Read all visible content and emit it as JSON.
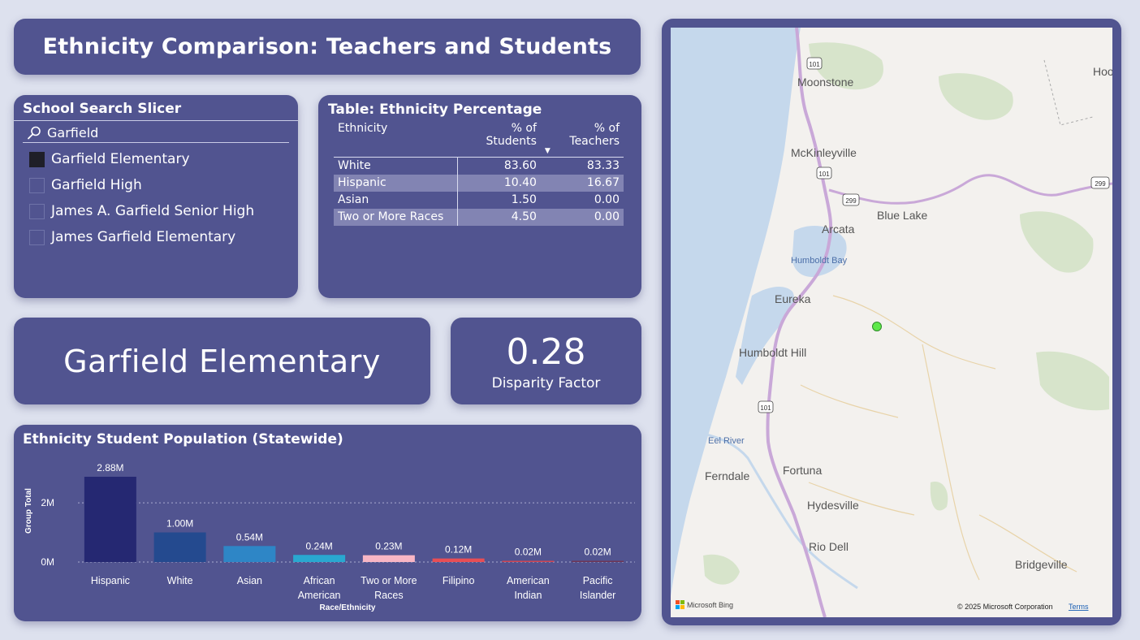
{
  "title": "Ethnicity Comparison: Teachers and Students",
  "slicer": {
    "title": "School Search Slicer",
    "search_value": "Garfield",
    "items": [
      {
        "label": "Garfield Elementary",
        "checked": true
      },
      {
        "label": "Garfield High",
        "checked": false
      },
      {
        "label": "James A. Garfield Senior High",
        "checked": false
      },
      {
        "label": "James Garfield Elementary",
        "checked": false
      }
    ]
  },
  "table": {
    "title": "Table: Ethnicity Percentage",
    "columns": [
      "Ethnicity",
      "% of Students",
      "% of Teachers"
    ],
    "rows": [
      [
        "White",
        "83.60",
        "83.33"
      ],
      [
        "Hispanic",
        "10.40",
        "16.67"
      ],
      [
        "Asian",
        "1.50",
        "0.00"
      ],
      [
        "Two or More Races",
        "4.50",
        "0.00"
      ]
    ]
  },
  "school_card": {
    "name": "Garfield Elementary"
  },
  "kpi": {
    "value": "0.28",
    "label": "Disparity Factor"
  },
  "chart_data": {
    "type": "bar",
    "title": "Ethnicity Student Population (Statewide)",
    "xlabel": "Race/Ethnicity",
    "ylabel": "Group Total",
    "categories": [
      [
        "Hispanic"
      ],
      [
        "White"
      ],
      [
        "Asian"
      ],
      [
        "African",
        "American"
      ],
      [
        "Two or More",
        "Races"
      ],
      [
        "Filipino"
      ],
      [
        "American",
        "Indian"
      ],
      [
        "Pacific",
        "Islander"
      ]
    ],
    "values": [
      2.88,
      1.0,
      0.54,
      0.24,
      0.23,
      0.12,
      0.02,
      0.02
    ],
    "data_labels": [
      "2.88M",
      "1.00M",
      "0.54M",
      "0.24M",
      "0.23M",
      "0.12M",
      "0.02M",
      "0.02M"
    ],
    "colors": [
      "#252872",
      "#244a8f",
      "#2e86c6",
      "#29a8d0",
      "#f8b6c5",
      "#e84e55",
      "#d04653",
      "#6e3555"
    ],
    "yticks": [
      {
        "value": 0,
        "label": "0M"
      },
      {
        "value": 2,
        "label": "2M"
      }
    ],
    "ylim": [
      0,
      2.88
    ],
    "grid": true
  },
  "map": {
    "places": [
      "Moonstone",
      "McKinleyville",
      "Blue Lake",
      "Arcata",
      "Humboldt Bay",
      "Eureka",
      "Humboldt Hill",
      "Eel River",
      "Ferndale",
      "Fortuna",
      "Hydesville",
      "Rio Dell",
      "Bridgeville",
      "Hoo"
    ],
    "highways": [
      "101",
      "101",
      "299",
      "299",
      "101"
    ],
    "brand": "Microsoft Bing",
    "copyright": "© 2025 Microsoft Corporation",
    "terms": "Terms",
    "marker_color": "#5ee84a"
  }
}
